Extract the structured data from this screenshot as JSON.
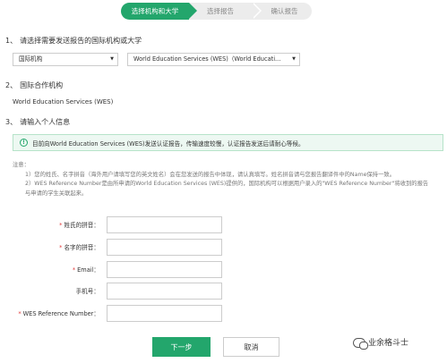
{
  "steps": {
    "step1": "选择机构和大学",
    "step2": "选择报告",
    "step3": "确认报告"
  },
  "section1": {
    "number": "1、",
    "title": "请选择需要发送报告的国际机构或大学",
    "select_type": "国际机构",
    "select_org": "World Education Services (WES)（World Educati..."
  },
  "section2": {
    "number": "2、",
    "title": "国际合作机构",
    "value": "World Education Services (WES)"
  },
  "section3": {
    "number": "3、",
    "title": "请输入个人信息",
    "info": "目前向World Education Services (WES)发送认证报告，传输速度较慢，认证报告发送后请耐心等候。"
  },
  "notes": {
    "heading": "注意：",
    "note1": "1）您的姓氏、名字拼音（海外用户请填写您的英文姓名）会在您发送的报告中体现，请认真填写。姓名拼音请与您报告翻译件中的Name保持一致。",
    "note2": "2）WES Reference Number是由所申请的World Education Services (WES)提供的，国际机构可以根据用户录入的\"WES Reference Number\"将收到的报告与申请的学生关联起来。"
  },
  "form": {
    "required_mark": "*",
    "last_name_label": "姓氏的拼音：",
    "first_name_label": "名字的拼音：",
    "email_label": "Email：",
    "phone_label": "手机号：",
    "wes_label": "WES Reference Number："
  },
  "buttons": {
    "next": "下一步",
    "cancel": "取消"
  },
  "watermark": {
    "text": "业余格斗士"
  },
  "colors": {
    "accent": "#23a66c",
    "info_bg": "#edf8f2",
    "required": "#e23b3b"
  }
}
